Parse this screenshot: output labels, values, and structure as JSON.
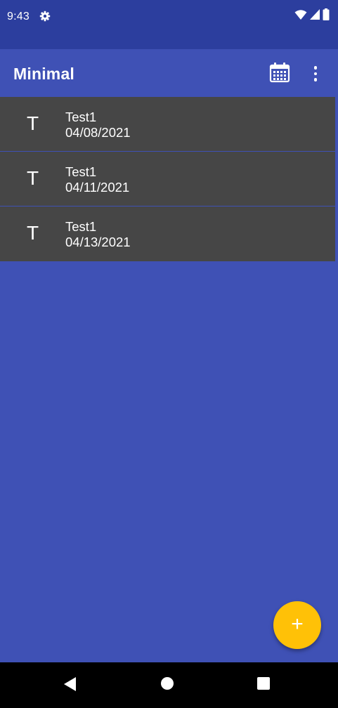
{
  "status_bar": {
    "time": "9:43",
    "icons": [
      "gear-icon",
      "wifi-icon",
      "signal-icon",
      "battery-icon"
    ]
  },
  "app_bar": {
    "title": "Minimal",
    "actions": [
      "calendar-icon",
      "more-vert-icon"
    ]
  },
  "list": {
    "items": [
      {
        "letter": "T",
        "title": "Test1",
        "date": "04/08/2021"
      },
      {
        "letter": "T",
        "title": "Test1",
        "date": "04/11/2021"
      },
      {
        "letter": "T",
        "title": "Test1",
        "date": "04/13/2021"
      }
    ]
  },
  "fab": {
    "label": "+",
    "icon": "add-icon"
  },
  "nav_bar": {
    "icons": [
      "back-icon",
      "home-icon",
      "recents-icon"
    ]
  },
  "colors": {
    "primary": "#3f51b5",
    "primary_dark": "#2c3e9e",
    "accent": "#ffc107",
    "list_item_bg": "#464646"
  }
}
